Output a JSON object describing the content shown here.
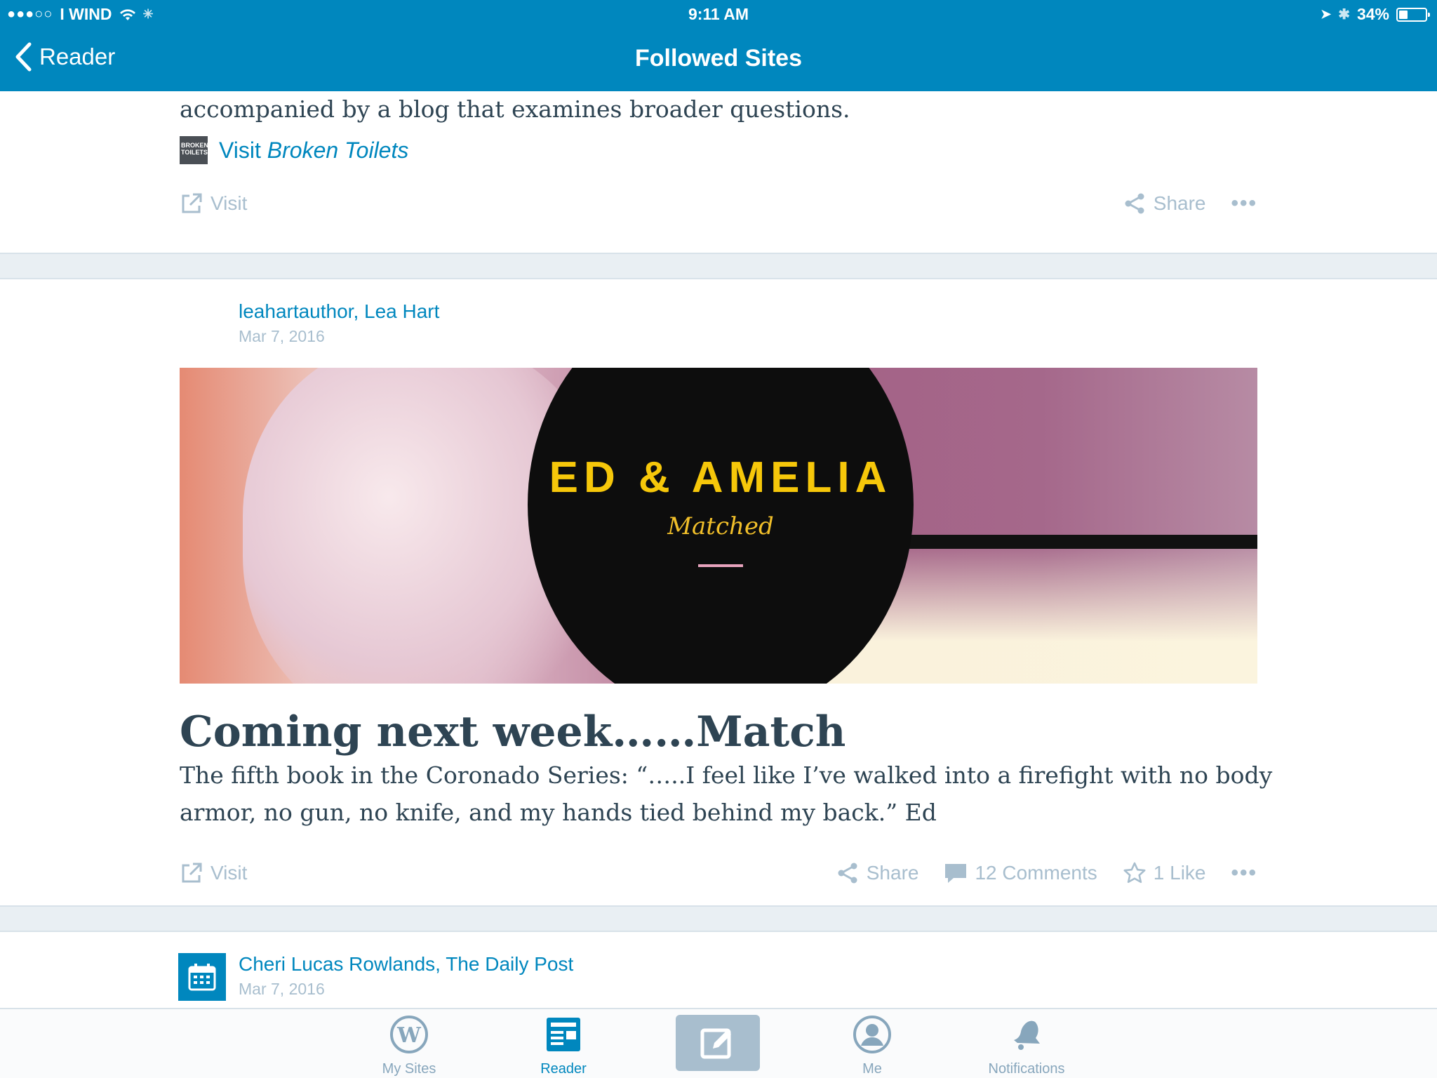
{
  "status_bar": {
    "carrier": "I WIND",
    "time": "9:11 AM",
    "battery": "34%"
  },
  "nav": {
    "back_label": "Reader",
    "title": "Followed Sites"
  },
  "card1": {
    "excerpt_end": "accompanied by a blog that examines broader questions.",
    "visit_site_prefix": "Visit",
    "visit_site_name": "Broken Toilets",
    "site_thumb_text": "BROKEN TOILETS",
    "visit_label": "Visit",
    "share_label": "Share",
    "more_label": "•••"
  },
  "card2": {
    "author": "leahartauthor, Lea Hart",
    "date": "Mar 7, 2016",
    "image_title": "ED & AMELIA",
    "image_subtitle": "Matched",
    "title": "Coming next week……Match",
    "excerpt": "The fifth book in the Coronado Series: “…..I feel like I’ve walked into a firefight with no body armor, no gun, no knife, and my hands tied behind my back.” Ed",
    "visit_label": "Visit",
    "share_label": "Share",
    "comments_label": "12 Comments",
    "like_label": "1 Like",
    "more_label": "•••"
  },
  "card3": {
    "author": "Cheri Lucas Rowlands, The Daily Post",
    "date": "Mar 7, 2016"
  },
  "tabs": [
    {
      "label": "My Sites",
      "icon": "wordpress-icon"
    },
    {
      "label": "Reader",
      "icon": "reader-icon"
    },
    {
      "label": "",
      "icon": "write-icon"
    },
    {
      "label": "Me",
      "icon": "user-icon"
    },
    {
      "label": "Notifications",
      "icon": "bell-icon"
    }
  ],
  "colors": {
    "brand_blue": "#0087be",
    "muted": "#a8bece",
    "text_dark": "#2e4453",
    "accent_yellow": "#f6c70a"
  }
}
